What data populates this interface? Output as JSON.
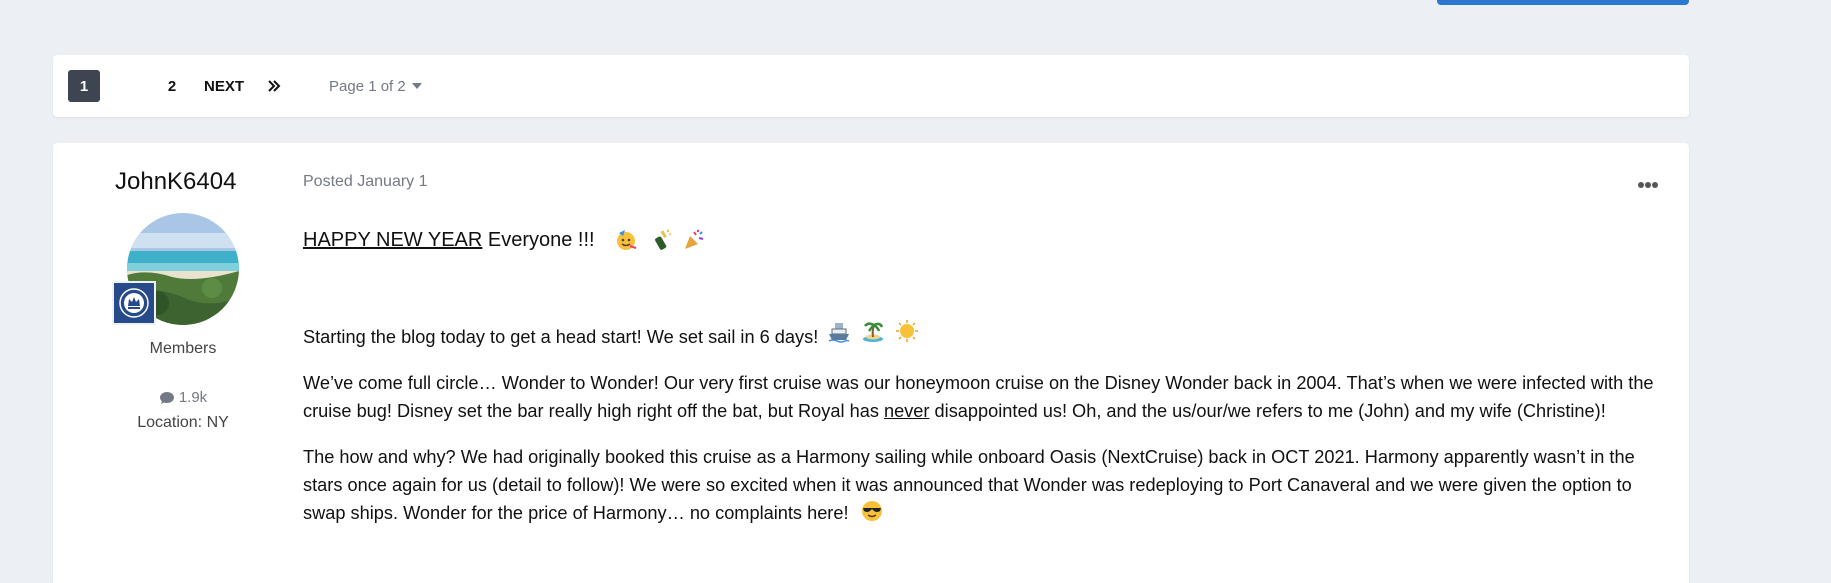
{
  "pagination": {
    "pages": [
      "1",
      "2"
    ],
    "active": "1",
    "next_label": "NEXT",
    "jump_label": "Page 1 of 2"
  },
  "post": {
    "author": {
      "name": "JohnK6404",
      "group": "Members",
      "posts_count": "1.9k",
      "location": "Location: NY"
    },
    "posted": "Posted January 1",
    "content": {
      "headline_underlined": "HAPPY NEW YEAR",
      "headline_rest": " Everyone !!! ",
      "p1": "Starting the blog today to get a head start! We set sail in 6 days! ",
      "p2_a": "We’ve come full circle… Wonder to Wonder! Our very first cruise was our honeymoon cruise on the Disney Wonder back in 2004. That’s when we were infected with the cruise bug! Disney set the bar really high right off the bat, but Royal has ",
      "p2_underlined": "never",
      "p2_b": " disappointed us! Oh, and the us/our/we refers to me (John) and my wife (Christine)!",
      "p3": "The how and why? We had originally booked this cruise as a Harmony sailing while onboard Oasis (NextCruise) back in OCT 2021. Harmony apparently wasn’t in the stars once again for us (detail to follow)! We were so excited when it was announced that Wonder was redeploying to Port Canaveral and we were given the option to swap ships. Wonder for the price of Harmony… no complaints here! "
    }
  },
  "colors": {
    "background": "#eceff4",
    "accent_button": "#2a78d1",
    "active_page": "#3d4452",
    "muted_text": "#737a85",
    "rank_badge": "#264a8a"
  },
  "icons": [
    "double-chevron-right-icon",
    "caret-down-icon",
    "comment-icon",
    "more-options-icon",
    "royal-caribbean-crown-icon",
    "partying-face-icon",
    "champagne-icon",
    "party-popper-icon",
    "ship-icon",
    "island-icon",
    "sun-icon",
    "sunglasses-face-icon"
  ]
}
